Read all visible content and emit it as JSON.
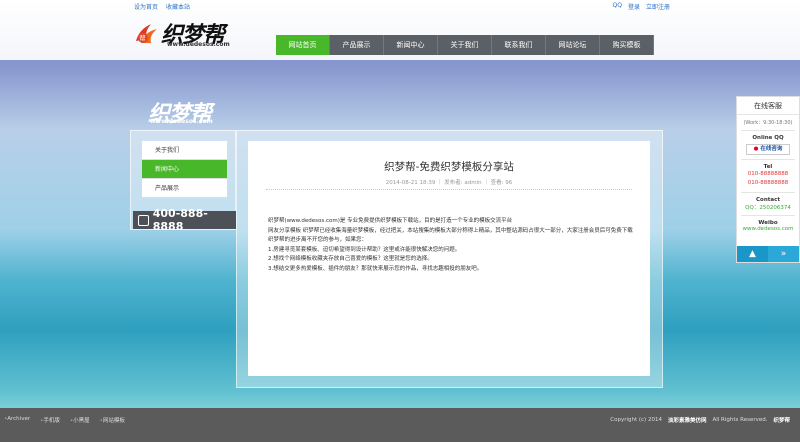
{
  "header": {
    "top_links": [
      "设为首页",
      "收藏本站"
    ],
    "qq_label": "QQ",
    "login": "登录",
    "register": "立即注册",
    "logo_text": "织梦帮",
    "logo_url": "www.dedesos.com"
  },
  "nav": {
    "items": [
      "网站首页",
      "产品展示",
      "新闻中心",
      "关于我们",
      "联系我们",
      "网站论坛",
      "购买模板"
    ],
    "active_index": 0
  },
  "banner": {
    "logo_text": "织梦帮",
    "logo_url": "www.dedesos.com"
  },
  "sidebar": {
    "items": [
      "关于我们",
      "新闻中心",
      "产品展示"
    ],
    "active_index": 1,
    "phone": "400-888-8888"
  },
  "article": {
    "title": "织梦帮-免费织梦模板分享站",
    "meta": "2014-08-21 18:39 ｜ 发布者: admin ｜ 查看: 96",
    "paragraphs": [
      "织梦帮(www.dedesos.com)是 专业免费提供织梦模板下载站，目的是打造一个专业的模板交流平台",
      "网友分享模板 织梦帮已经收集海量织梦模板，经过把关，本站搜集的模板大部分称得上精品，其中整站源码占很大一部分，大家注册会员后可免费下载",
      "织梦帮的进步离不开您的参与，如果您：",
      "1.房建寻觅某套模板、迫切希望得到设计帮助？这里或许能很快解决您的问题。",
      "2.想找个网络模板收藏夹存放自己喜爱的模板？这里就是您的选择。",
      "3.想结交更多热爱模板、插件的朋友？那就快来展示您的作品，寻找志趣相投的朋友吧。"
    ]
  },
  "service": {
    "title": "在线客服",
    "hours": "(Work：9:30-18:30)",
    "qq_label": "Online QQ",
    "qq_button": "在线咨询",
    "tel_label": "Tel",
    "tel1": "010-88888888",
    "tel2": "010-88888888",
    "contact_label": "Contact",
    "contact_qq": "QQ：250206374",
    "weibo_label": "Weibo",
    "weibo": "www.dedesos.com"
  },
  "footer": {
    "links": [
      "Archiver",
      "手机版",
      "小黑屋",
      "网站模板"
    ],
    "copyright": "Copyright (c) 2014",
    "site_name": "淡彩素雅美仿网",
    "rights": "All Rights Reserved.",
    "brand": "织梦帮"
  }
}
